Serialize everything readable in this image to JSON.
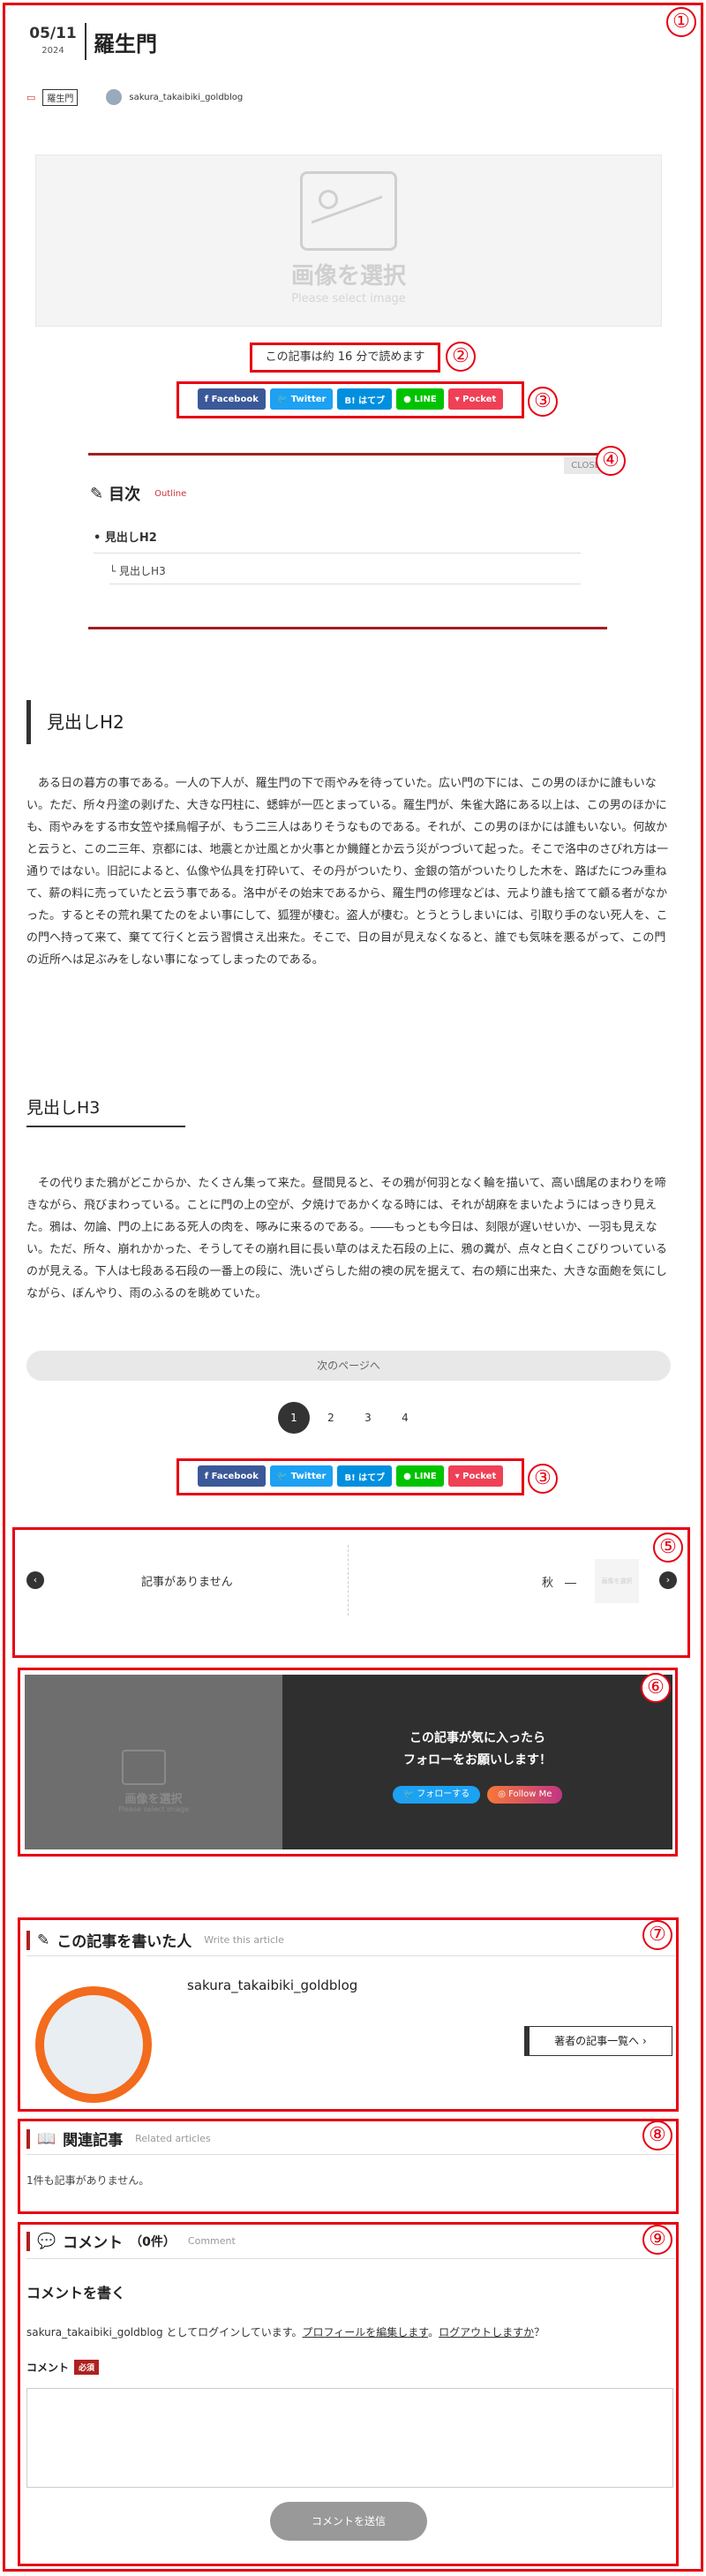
{
  "post": {
    "date_md": "05/11",
    "year": "2024",
    "title": "羅生門",
    "category": "羅生門",
    "author": "sakura_takaibiki_goldblog"
  },
  "hero": {
    "title": "画像を選択",
    "subtitle": "Please select image"
  },
  "readtime": "この記事は約 16 分で読めます",
  "share": {
    "facebook": "Facebook",
    "twitter": "Twitter",
    "hatena": "B! はてブ",
    "line": "LINE",
    "pocket": "Pocket"
  },
  "toc": {
    "close": "CLOSE",
    "title": "目次",
    "sub": "Outline",
    "items": [
      "見出しH2",
      "見出しH3"
    ]
  },
  "h2": "見出しH2",
  "para1": "ある日の暮方の事である。一人の下人が、羅生門の下で雨やみを待っていた。広い門の下には、この男のほかに誰もいない。ただ、所々丹塗の剥げた、大きな円柱に、蟋蟀が一匹とまっている。羅生門が、朱雀大路にある以上は、この男のほかにも、雨やみをする市女笠や揉烏帽子が、もう二三人はありそうなものである。それが、この男のほかには誰もいない。何故かと云うと、この二三年、京都には、地震とか辻風とか火事とか饑饉とか云う災がつづいて起った。そこで洛中のさびれ方は一通りではない。旧記によると、仏像や仏具を打砕いて、その丹がついたり、金銀の箔がついたりした木を、路ばたにつみ重ねて、薪の料に売っていたと云う事である。洛中がその始末であるから、羅生門の修理などは、元より誰も捨てて顧る者がなかった。するとその荒れ果てたのをよい事にして、狐狸が棲む。盗人が棲む。とうとうしまいには、引取り手のない死人を、この門へ持って来て、棄てて行くと云う習慣さえ出来た。そこで、日の目が見えなくなると、誰でも気味を悪るがって、この門の近所へは足ぶみをしない事になってしまったのである。",
  "h3": "見出しH3",
  "para2": "その代りまた鴉がどこからか、たくさん集って来た。昼間見ると、その鴉が何羽となく輪を描いて、高い鴟尾のまわりを啼きながら、飛びまわっている。ことに門の上の空が、夕焼けであかくなる時には、それが胡麻をまいたようにはっきり見えた。鴉は、勿論、門の上にある死人の肉を、啄みに来るのである。――もっとも今日は、刻限が遅いせいか、一羽も見えない。ただ、所々、崩れかかった、そうしてその崩れ目に長い草のはえた石段の上に、鴉の糞が、点々と白くこびりついているのが見える。下人は七段ある石段の一番上の段に、洗いざらした紺の襖の尻を据えて、右の頬に出来た、大きな面皰を気にしながら、ぼんやり、雨のふるのを眺めていた。",
  "next_page": "次のページへ",
  "pages": [
    "1",
    "2",
    "3",
    "4"
  ],
  "prevnext": {
    "prev": "記事がありません",
    "next": "秋　―",
    "next_thumb": "画像を選択"
  },
  "follow": {
    "thumb": "画像を選択",
    "thumb_sub": "Please select image",
    "line1": "この記事が気に入ったら",
    "line2": "フォローをお願いします！",
    "twitter": "フォローする",
    "instagram": "Follow Me"
  },
  "about": {
    "title": "この記事を書いた人",
    "sub": "Write this article",
    "name": "sakura_takaibiki_goldblog",
    "button": "著者の記事一覧へ"
  },
  "related": {
    "title": "関連記事",
    "sub": "Related articles",
    "empty": "1件も記事がありません。"
  },
  "comments": {
    "title": "コメント",
    "count": "（0件）",
    "sub": "Comment",
    "write": "コメントを書く",
    "login_prefix": "sakura_takaibiki_goldblog としてログインしています。",
    "profile_link": "プロフィールを編集します",
    "logout_link": "ログアウトしますか",
    "label": "コメント",
    "required": "必須",
    "submit": "コメントを送信"
  },
  "markers": [
    "①",
    "②",
    "③",
    "④",
    "③",
    "⑤",
    "⑥",
    "⑦",
    "⑧",
    "⑨"
  ],
  "colors": {
    "accent": "#b02020",
    "facebook": "#3b5998",
    "twitter": "#1da1f2",
    "hatena": "#008fde",
    "line": "#00c300",
    "pocket": "#ef4056",
    "annotation": "#e60012"
  }
}
